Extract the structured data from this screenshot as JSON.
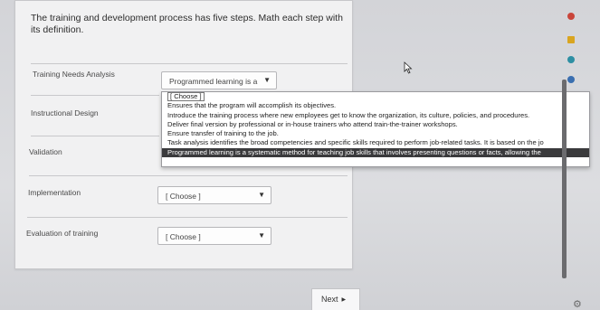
{
  "question": {
    "text": "The training and development process has five steps. Math each step with its definition."
  },
  "rows": [
    {
      "label": "Training Needs Analysis",
      "selected": "Programmed learning is a"
    },
    {
      "label": "Instructional Design",
      "selected": ""
    },
    {
      "label": "Validation",
      "selected": ""
    },
    {
      "label": "Implementation",
      "selected": "[ Choose ]"
    },
    {
      "label": "Evaluation of training",
      "selected": "[ Choose ]"
    }
  ],
  "dropdown": {
    "options": [
      "[ Choose ]",
      "Ensures that the program will accomplish its objectives.",
      "Introduce the training process where new employees get to know the organization, its culture, policies, and procedures.",
      "Deliver final version by professional or in-house trainers who attend train-the-trainer workshops.",
      "Ensure transfer of training to the job.",
      "Task analysis identifies the broad competencies and specific skills required to perform job-related tasks. It is based on the jo",
      "Programmed learning is a systematic method for teaching job skills that involves presenting questions or facts, allowing the"
    ],
    "highlighted_index": 6
  },
  "nav": {
    "next_label": "Next"
  },
  "colors": {
    "sidebar_red": "#c9453a",
    "sidebar_yellow": "#d9a520",
    "sidebar_teal": "#2e8fa3",
    "sidebar_blue": "#3a6fb0"
  }
}
